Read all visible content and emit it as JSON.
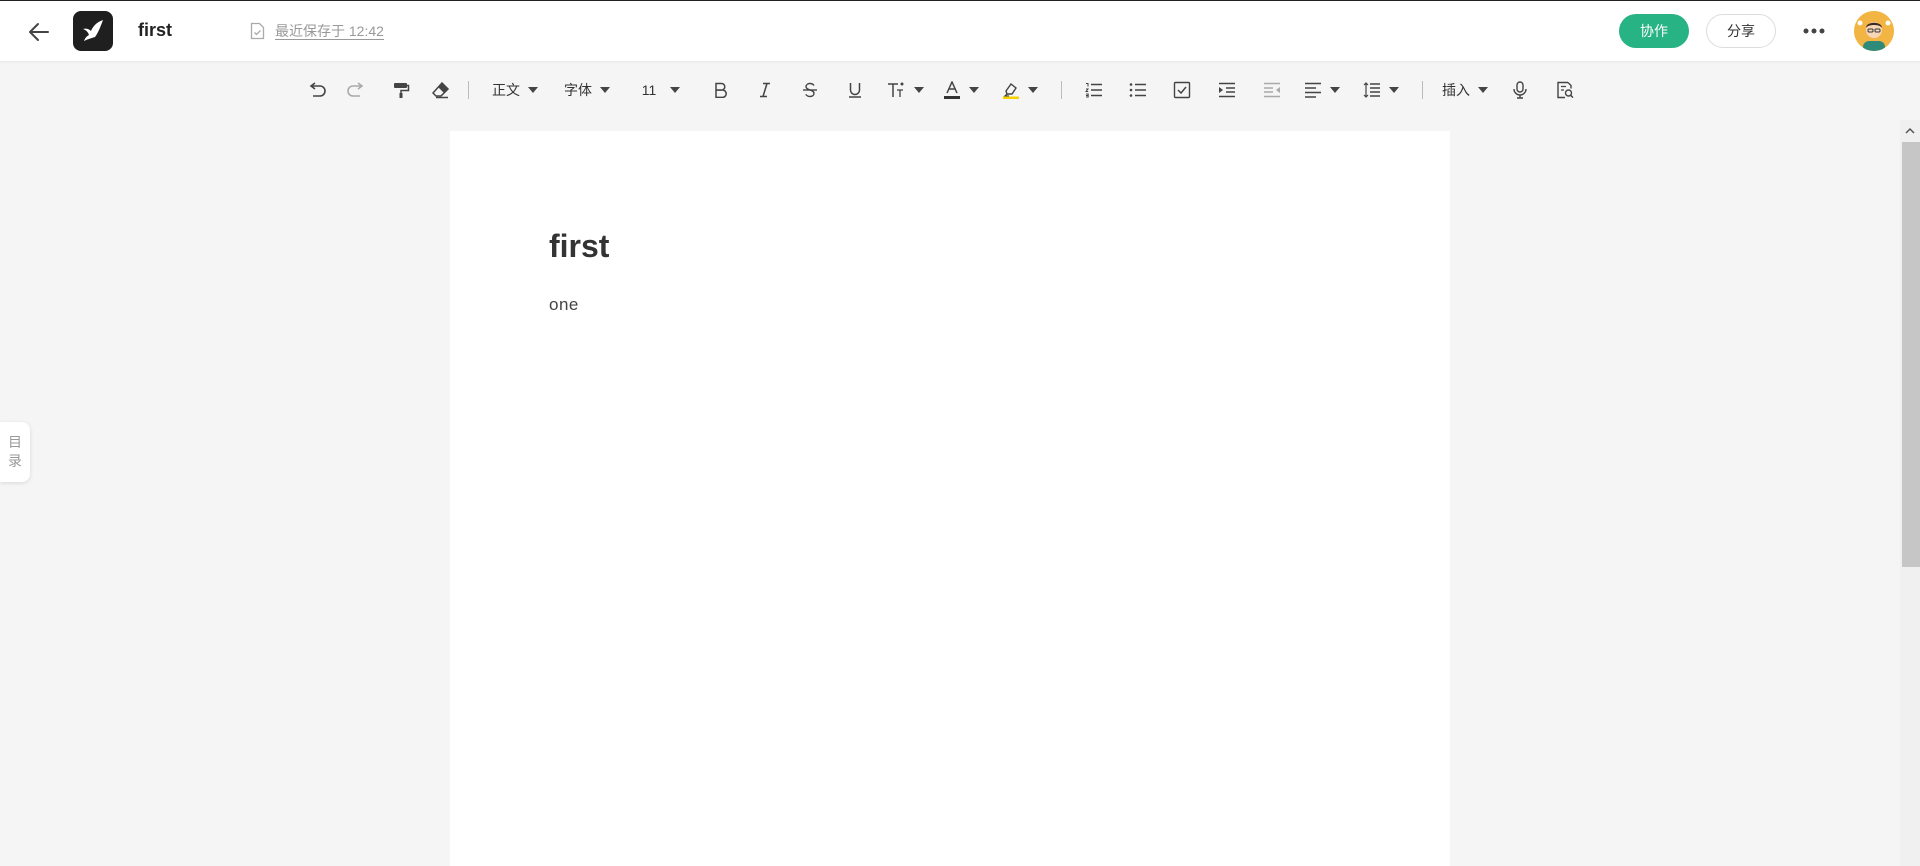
{
  "header": {
    "doc_title": "first",
    "save_status": "最近保存于 12:42",
    "collab_label": "协作",
    "share_label": "分享",
    "icons": {
      "back": "arrow-left-icon",
      "logo": "bird-logo",
      "save": "document-check-icon",
      "more": "ellipsis-icon"
    },
    "colors": {
      "collab_button": "#27b383",
      "logo_bg": "#1f1f1f",
      "avatar_bg": "#f2b544"
    }
  },
  "toolbar": {
    "paragraph_style": "正文",
    "font_family": "字体",
    "font_size": "11",
    "insert_label": "插入",
    "icons": [
      "undo-icon",
      "redo-icon",
      "format-painter-icon",
      "eraser-icon",
      "bold-icon",
      "italic-icon",
      "strikethrough-icon",
      "underline-icon",
      "text-effect-icon",
      "font-color-icon",
      "highlight-icon",
      "numbered-list-icon",
      "bullet-list-icon",
      "checklist-icon",
      "indent-icon",
      "outdent-icon",
      "align-icon",
      "line-spacing-icon",
      "microphone-icon",
      "find-replace-icon"
    ],
    "colors": {
      "font_color": "#333333",
      "highlight": "#f5d200"
    }
  },
  "document": {
    "heading": "first",
    "paragraph": "one"
  },
  "sidebar": {
    "outline_char1": "目",
    "outline_char2": "录"
  }
}
